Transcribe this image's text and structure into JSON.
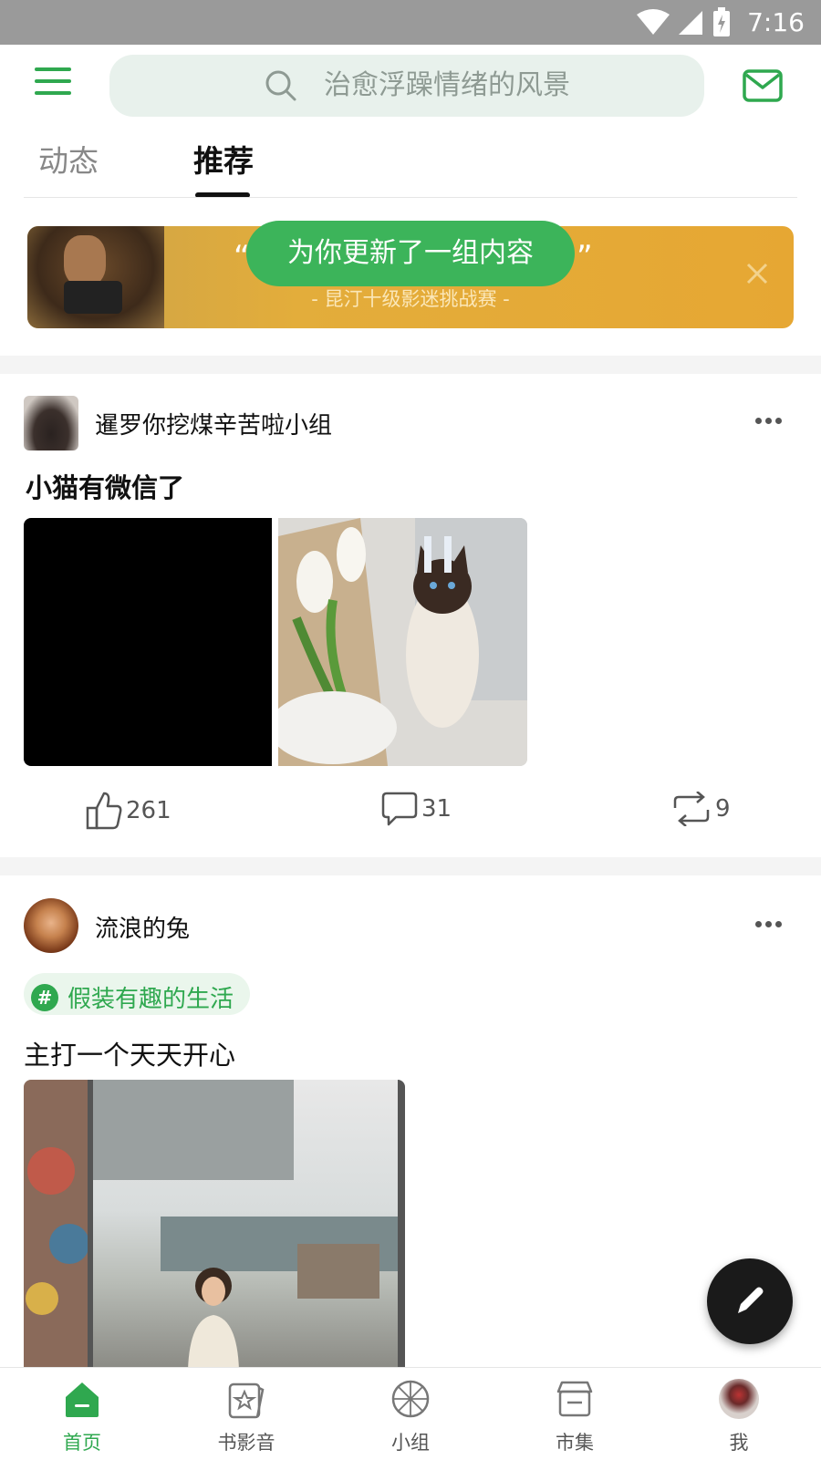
{
  "status_bar": {
    "time": "7:16"
  },
  "header": {
    "search_placeholder": "治愈浮躁情绪的风景"
  },
  "tabs": [
    {
      "label": "动态"
    },
    {
      "label": "推荐"
    }
  ],
  "banner": {
    "quote_open": "“",
    "quote_close": "”",
    "subtitle": "- 昆汀十级影迷挑战赛 -"
  },
  "toast": "为你更新了一组内容",
  "posts": [
    {
      "author": "暹罗你挖煤辛苦啦小组",
      "title": "小猫有微信了",
      "likes": "261",
      "comments": "31",
      "reposts": "9"
    },
    {
      "author": "流浪的兔",
      "topic": "假装有趣的生活",
      "topic_hash": "#",
      "title": "主打一个天天开心"
    }
  ],
  "bottom_nav": [
    {
      "label": "首页",
      "icon": "home-icon",
      "active": true
    },
    {
      "label": "书影音",
      "icon": "book-movie-icon",
      "active": false
    },
    {
      "label": "小组",
      "icon": "group-icon",
      "active": false
    },
    {
      "label": "市集",
      "icon": "market-icon",
      "active": false
    },
    {
      "label": "我",
      "icon": "avatar-icon",
      "active": false
    }
  ],
  "colors": {
    "brand_green": "#2fa84f",
    "banner_gold": "#e3ad3b",
    "toast_green": "#3cb45a"
  }
}
